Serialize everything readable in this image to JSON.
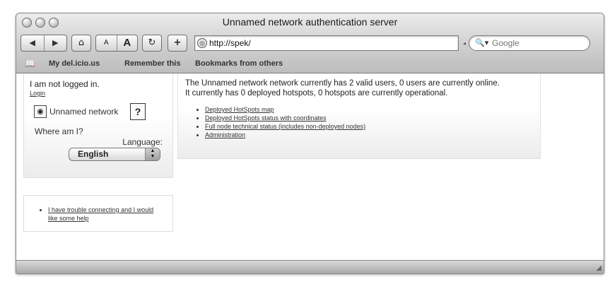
{
  "window": {
    "title": "Unnamed network authentication server"
  },
  "toolbar": {
    "back_icon": "back-arrow-icon",
    "forward_icon": "forward-arrow-icon",
    "home_icon": "home-icon",
    "text_smaller": "A",
    "text_larger": "A",
    "reload_icon": "reload-icon",
    "add_bookmark": "+",
    "url": "http://spek/",
    "search_placeholder": "Google"
  },
  "bookmarks_bar": {
    "items": [
      "My del.icio.us",
      "Remember this",
      "Bookmarks from others"
    ]
  },
  "sidebar": {
    "login_status": "I am not logged in.",
    "login_link": "Login",
    "network_name": "Unnamed network",
    "help_button": "?",
    "where_am_i": "Where am I?",
    "language_label": "Language:",
    "language_selected": "English",
    "help_links": [
      "I have trouble connecting and I would like some help"
    ]
  },
  "main": {
    "status_line1": "The Unnamed network network currently has 2 valid users, 0 users are currently online.",
    "status_line2": "It currently has 0 deployed hotspots, 0 hotspots are currently operational.",
    "links": [
      "Deployed HotSpots map",
      "Deployed HotSpots status with coordinates",
      "Full node technical status (includes non-deployed nodes)",
      "Administration"
    ]
  }
}
